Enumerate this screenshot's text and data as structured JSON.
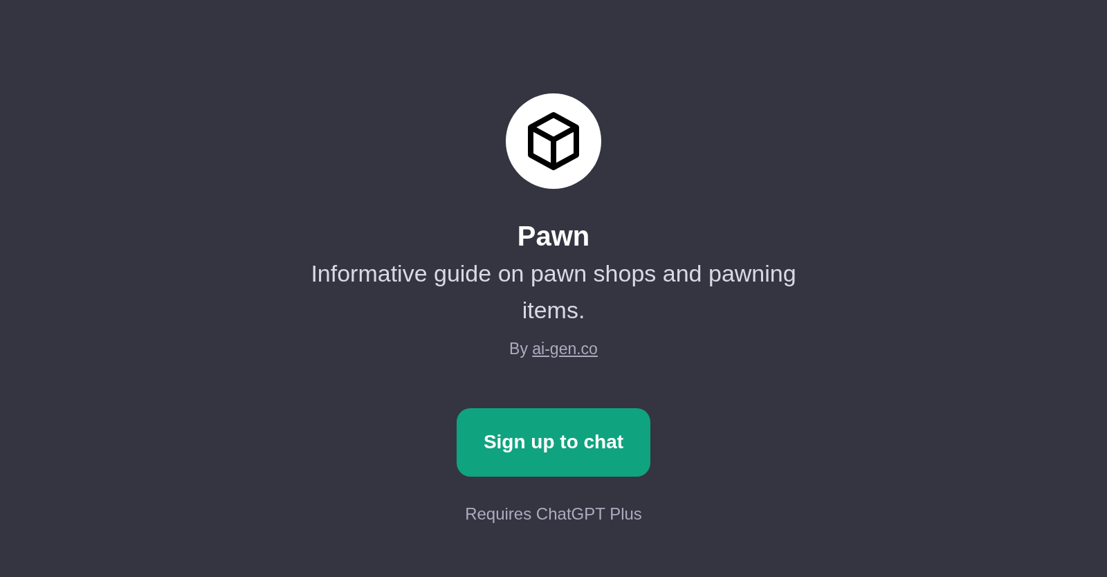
{
  "title": "Pawn",
  "description": "Informative guide on pawn shops and pawning items.",
  "author": {
    "prefix": "By",
    "link": "ai-gen.co"
  },
  "button": "Sign up to chat",
  "note": "Requires ChatGPT Plus"
}
